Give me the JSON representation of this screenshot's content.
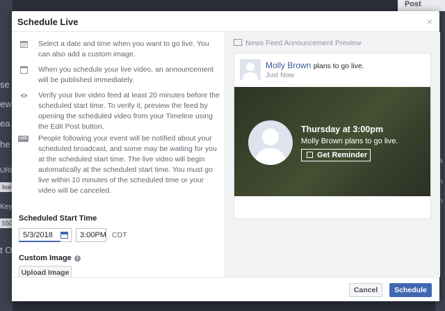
{
  "background": {
    "fragments": [
      "se",
      "ew",
      "ea",
      "he",
      "URL",
      "live",
      "Key",
      "550",
      "t O"
    ],
    "post_tab": "Post",
    "right_fragments": [
      "a",
      "n",
      "n"
    ]
  },
  "modal": {
    "title": "Schedule Live",
    "close_symbol": "×"
  },
  "info": [
    {
      "icon": "calendar-icon",
      "text": "Select a date and time when you want to go live. You can also add a custom image."
    },
    {
      "icon": "news-feed-icon",
      "text": "When you schedule your live video, an announcement will be published immediately."
    },
    {
      "icon": "eye-icon",
      "text": "Verify your live video feed at least 20 minutes before the scheduled start time. To verify it, preview the feed by opening the scheduled video from your Timeline using the Edit Post button."
    },
    {
      "icon": "live-badge-icon",
      "text": "People following your event will be notified about your scheduled broadcast, and some may be waiting for you at the scheduled start time. The live video will begin automatically at the scheduled start time. You must go live within 10 minutes of the scheduled time or your video will be canceled."
    }
  ],
  "live_badge": "LIVE",
  "schedule": {
    "label": "Scheduled Start Time",
    "date": "5/3/2018",
    "time": "3:00PM",
    "timezone": "CDT"
  },
  "custom_image": {
    "label": "Custom Image",
    "help": "i",
    "upload_label": "Upload Image"
  },
  "preview": {
    "heading": "News Feed Announcement Preview",
    "user_name": "Molly Brown",
    "action": "plans to go live.",
    "timestamp": "Just Now",
    "when": "Thursday at 3:00pm",
    "line": "Molly Brown plans to go live.",
    "reminder_label": "Get Reminder"
  },
  "footer": {
    "cancel_label": "Cancel",
    "schedule_label": "Schedule"
  },
  "colors": {
    "accent": "#4267b2",
    "link": "#365899"
  }
}
